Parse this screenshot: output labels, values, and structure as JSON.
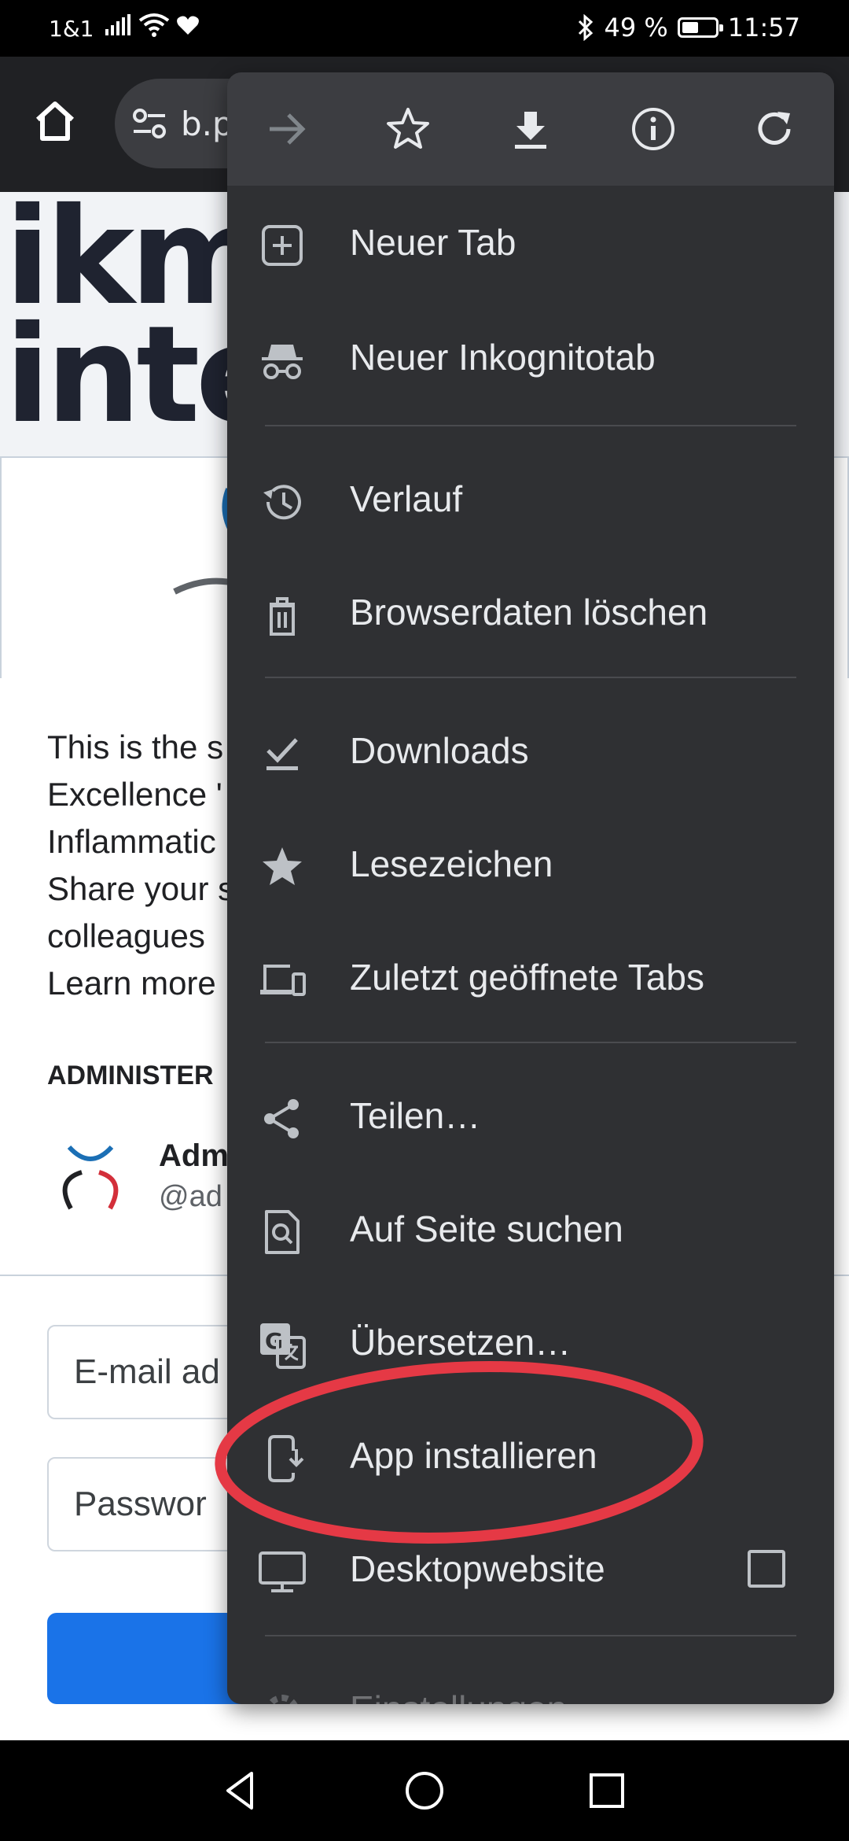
{
  "status_bar": {
    "carrier": "1&1",
    "battery": "49 %",
    "battery_level": 0.49,
    "time": "11:57"
  },
  "toolbar": {
    "url": "b.p"
  },
  "menu": {
    "top_buttons": [
      "forward-icon",
      "star-icon",
      "download-icon",
      "info-icon",
      "refresh-icon"
    ],
    "items": [
      {
        "label": "Neuer Tab",
        "icon": "new-tab-icon"
      },
      {
        "label": "Neuer Inkognitotab",
        "icon": "incognito-icon"
      },
      {
        "label": "Verlauf",
        "icon": "history-icon"
      },
      {
        "label": "Browserdaten löschen",
        "icon": "trash-icon"
      },
      {
        "label": "Downloads",
        "icon": "downloads-icon"
      },
      {
        "label": "Lesezeichen",
        "icon": "bookmarks-star-icon"
      },
      {
        "label": "Zuletzt geöffnete Tabs",
        "icon": "devices-icon"
      },
      {
        "label": "Teilen…",
        "icon": "share-icon"
      },
      {
        "label": "Auf Seite suchen",
        "icon": "find-in-page-icon"
      },
      {
        "label": "Übersetzen…",
        "icon": "translate-icon"
      },
      {
        "label": "App installieren",
        "icon": "install-app-icon"
      },
      {
        "label": "Desktopwebsite",
        "icon": "desktop-icon",
        "checked": false
      },
      {
        "label": "Einstellungen",
        "icon": "settings-icon"
      }
    ]
  },
  "page": {
    "hero_text": [
      "ikm",
      "inte"
    ],
    "description": [
      "This is the s",
      "Excellence '",
      "Inflammatic",
      "Share your s",
      "colleagues",
      "Learn more"
    ],
    "admin_title": "ADMINISTER",
    "admin_name": "Adm",
    "admin_handle": "@ad",
    "email_placeholder": "E-mail ad",
    "password_placeholder": "Passwor"
  },
  "colors": {
    "menu_bg": "#2f3033",
    "menu_top_bg": "#3c3d41",
    "annotation": "#e53945",
    "accent": "#1a73e8"
  }
}
